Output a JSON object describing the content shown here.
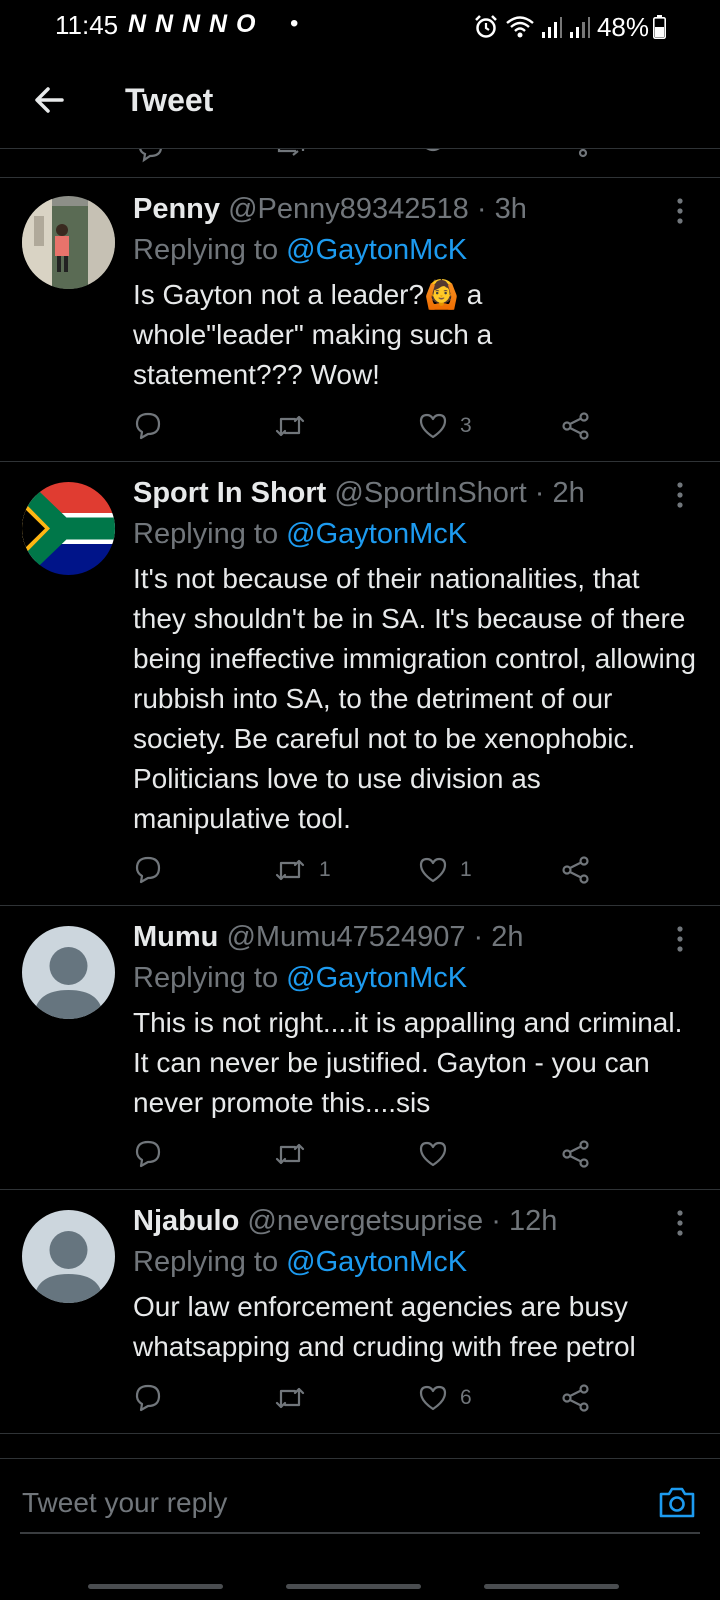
{
  "status_bar": {
    "time": "11:45",
    "notification_icons": "N N N N O",
    "dot": "•",
    "battery": "48%"
  },
  "header": {
    "title": "Tweet"
  },
  "replies": [
    {
      "name": "Penny",
      "handle": "@Penny89342518",
      "time": "3h",
      "replying_label": "Replying to",
      "replying_to": "@GaytonMcK",
      "text": "Is Gayton not a leader?🙆 a whole\"leader\" making such a statement??? Wow!",
      "retweets": "",
      "likes": "3",
      "avatar": "photo-avatar"
    },
    {
      "name": "Sport In Short",
      "handle": "@SportInShort",
      "time": "2h",
      "replying_label": "Replying to",
      "replying_to": "@GaytonMcK",
      "text": "It's not because of their nationalities, that they shouldn't be in SA. It's because of there being ineffective immigration control, allowing rubbish into SA, to the detriment of our society. Be careful not to be xenophobic. Politicians love to use division as manipulative tool.",
      "retweets": "1",
      "likes": "1",
      "avatar": "south-africa-flag-avatar"
    },
    {
      "name": "Mumu",
      "handle": "@Mumu47524907",
      "time": "2h",
      "replying_label": "Replying to",
      "replying_to": "@GaytonMcK",
      "text": "This is not right....it is appalling and criminal. It can never be justified. Gayton - you can never promote this....sis",
      "retweets": "",
      "likes": "",
      "avatar": "default-avatar"
    },
    {
      "name": "Njabulo",
      "handle": "@nevergetsuprise",
      "time": "12h",
      "replying_label": "Replying to",
      "replying_to": "@GaytonMcK",
      "text": "Our law enforcement agencies are busy whatsapping and cruding with free petrol",
      "retweets": "",
      "likes": "6",
      "avatar": "default-avatar"
    }
  ],
  "compose": {
    "placeholder": "Tweet your reply"
  },
  "colors": {
    "background": "#000000",
    "text": "#e7e9ea",
    "muted": "#71767b",
    "accent": "#1d9bf0",
    "divider": "#2f3336"
  }
}
